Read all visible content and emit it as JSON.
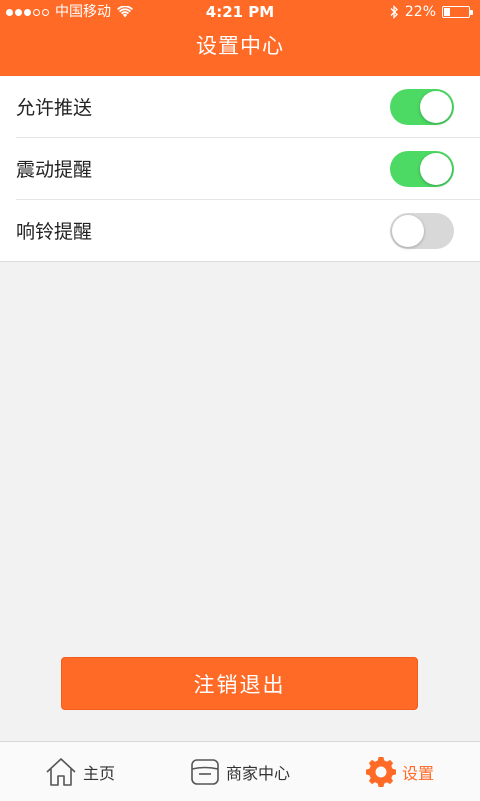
{
  "status_bar": {
    "carrier": "中国移动",
    "time": "4:21 PM",
    "battery_percent": "22%",
    "signal_filled": 3,
    "signal_total": 5
  },
  "header": {
    "title": "设置中心"
  },
  "settings": [
    {
      "label": "允许推送",
      "enabled": true
    },
    {
      "label": "震动提醒",
      "enabled": true
    },
    {
      "label": "响铃提醒",
      "enabled": false
    }
  ],
  "logout_label": "注销退出",
  "tabs": [
    {
      "label": "主页",
      "icon": "home-icon",
      "active": false
    },
    {
      "label": "商家中心",
      "icon": "store-icon",
      "active": false
    },
    {
      "label": "设置",
      "icon": "gear-icon",
      "active": true
    }
  ],
  "colors": {
    "brand": "#ff6a27",
    "toggle_on": "#4cd964",
    "toggle_off": "#d8d8d8"
  }
}
